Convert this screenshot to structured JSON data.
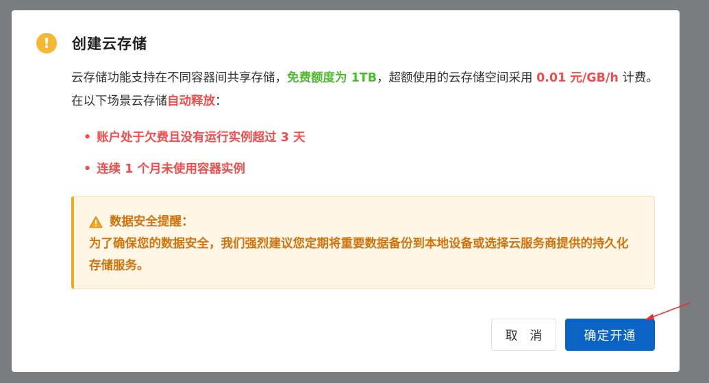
{
  "dialog": {
    "title": "创建云存储",
    "description": {
      "part1": "云存储功能支持在不同容器间共享存储，",
      "free_quota": "免费额度为 1TB",
      "part2": "，超额使用的云存储空间采用 ",
      "price": "0.01 元/GB/h",
      "part3": " 计费。在以下场景云存储",
      "auto_release": "自动释放",
      "part4": "："
    },
    "bullets": [
      "账户处于欠费且没有运行实例超过 3 天",
      "连续 1 个月未使用容器实例"
    ],
    "alert": {
      "title": "数据安全提醒：",
      "body": "为了确保您的数据安全，我们强烈建议您定期将重要数据备份到本地设备或选择云服务商提供的持久化存储服务。"
    },
    "buttons": {
      "cancel": "取 消",
      "confirm": "确定开通"
    }
  },
  "colors": {
    "overlay": "#7b7c7e",
    "warning_icon": "#f4b833",
    "green_highlight": "#4cbc2c",
    "red_highlight": "#f24c4c",
    "alert_text": "#d4720c",
    "alert_bg": "#fff6e6",
    "primary": "#0b63c5",
    "annotation_arrow": "#e8322b"
  },
  "icons": {
    "title_icon": "exclamation-circle-icon",
    "alert_icon": "warning-triangle-icon"
  }
}
